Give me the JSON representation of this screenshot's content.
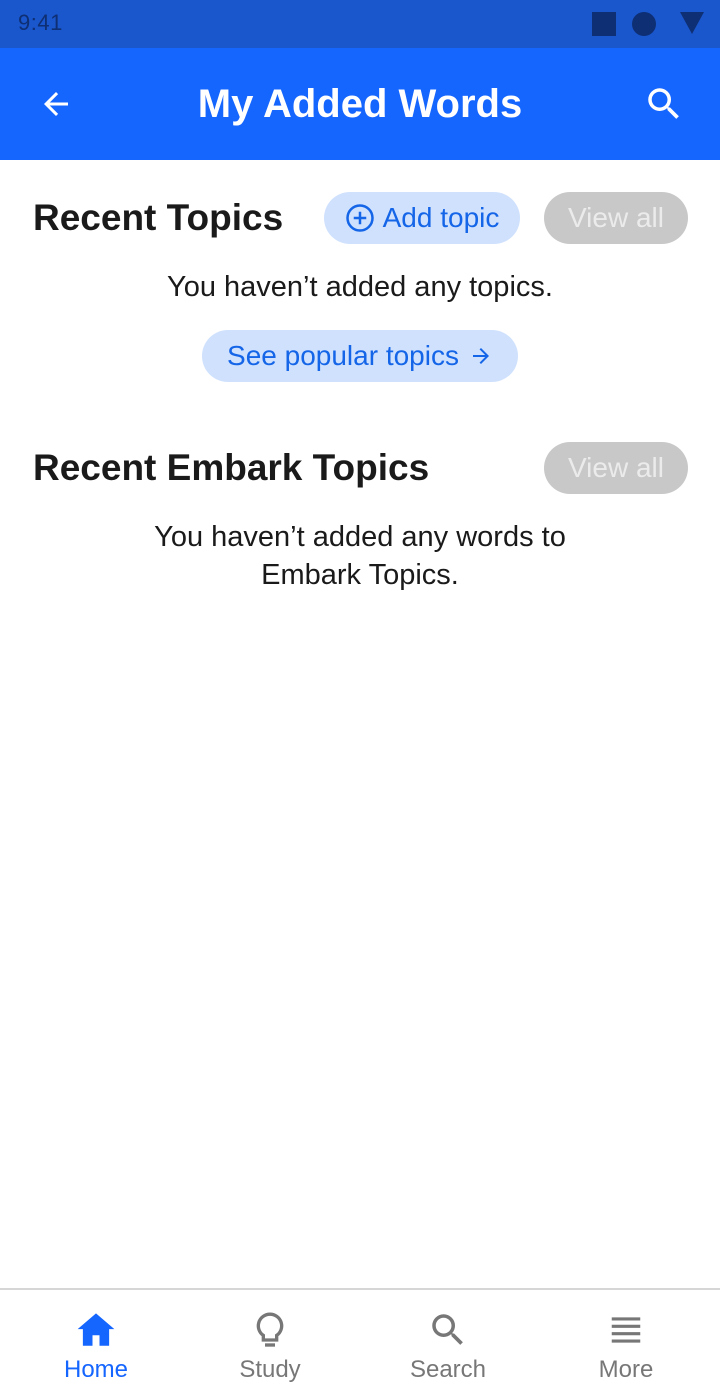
{
  "status_bar": {
    "time": "9:41"
  },
  "app_bar": {
    "title": "My Added Words",
    "back_icon": "arrow-left-icon",
    "search_icon": "search-icon"
  },
  "recent_topics": {
    "title": "Recent Topics",
    "add_topic_label": "Add topic",
    "view_all_label": "View all",
    "empty_text": "You haven’t added any topics.",
    "see_popular_label": "See popular topics"
  },
  "recent_embark_topics": {
    "title": "Recent Embark Topics",
    "view_all_label": "View all",
    "empty_text_line1": "You haven’t added any words to",
    "empty_text_line2": "Embark Topics."
  },
  "bottom_nav": {
    "items": [
      {
        "label": "Home",
        "icon": "home-icon",
        "active": true
      },
      {
        "label": "Study",
        "icon": "lightbulb-icon",
        "active": false
      },
      {
        "label": "Search",
        "icon": "search-icon",
        "active": false
      },
      {
        "label": "More",
        "icon": "menu-icon",
        "active": false
      }
    ]
  },
  "colors": {
    "primary": "#1565ff",
    "status_bar": "#1a56cc",
    "pill_primary_bg": "#cfe1fd",
    "pill_disabled_bg": "#c8c8c8",
    "nav_inactive": "#777777"
  }
}
